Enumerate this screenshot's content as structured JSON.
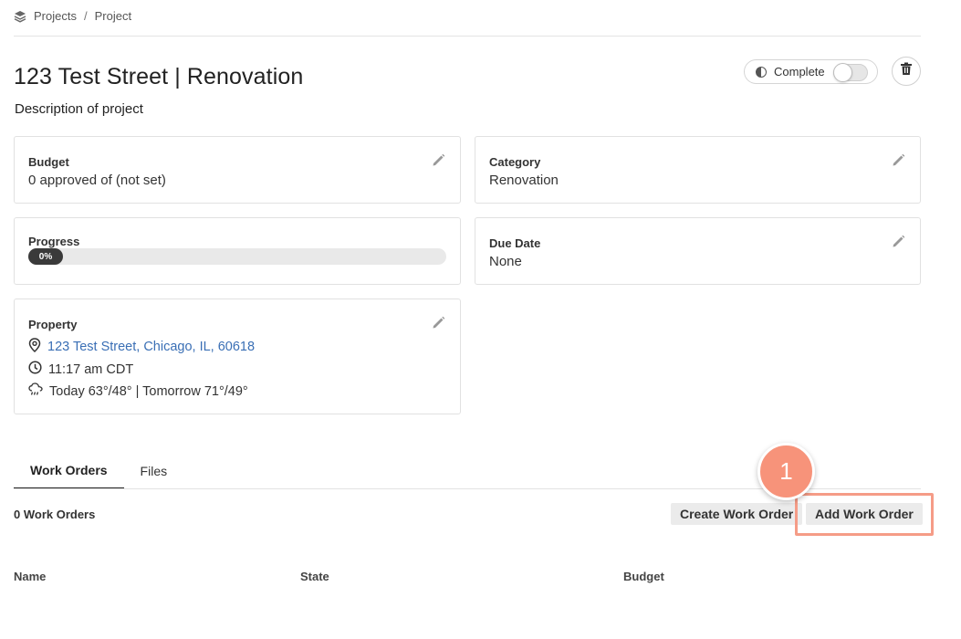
{
  "breadcrumb": {
    "root": "Projects",
    "separator": "/",
    "current": "Project"
  },
  "project": {
    "title": "123 Test Street | Renovation",
    "description": "Description of project"
  },
  "complete_toggle": {
    "label": "Complete",
    "on": false
  },
  "cards": {
    "budget": {
      "label": "Budget",
      "value": "0 approved of (not set)"
    },
    "category": {
      "label": "Category",
      "value": "Renovation"
    },
    "progress": {
      "label": "Progress",
      "value_text": "0%",
      "fraction": 0
    },
    "due_date": {
      "label": "Due Date",
      "value": "None"
    },
    "property": {
      "label": "Property",
      "address": "123 Test Street, Chicago, IL, 60618",
      "time": "11:17 am CDT",
      "weather": "Today 63°/48° | Tomorrow 71°/49°"
    }
  },
  "tabs": [
    {
      "label": "Work Orders",
      "active": true
    },
    {
      "label": "Files",
      "active": false
    }
  ],
  "work_orders": {
    "count_text": "0 Work Orders",
    "create_label": "Create Work Order",
    "add_label": "Add Work Order",
    "columns": [
      "Name",
      "State",
      "Budget"
    ]
  },
  "annotation": {
    "step": "1",
    "color": "#f7937a"
  },
  "icons": [
    "layers-icon",
    "half-circle-icon",
    "trash-icon",
    "pencil-icon",
    "map-pin-icon",
    "clock-icon",
    "rain-cloud-icon"
  ]
}
